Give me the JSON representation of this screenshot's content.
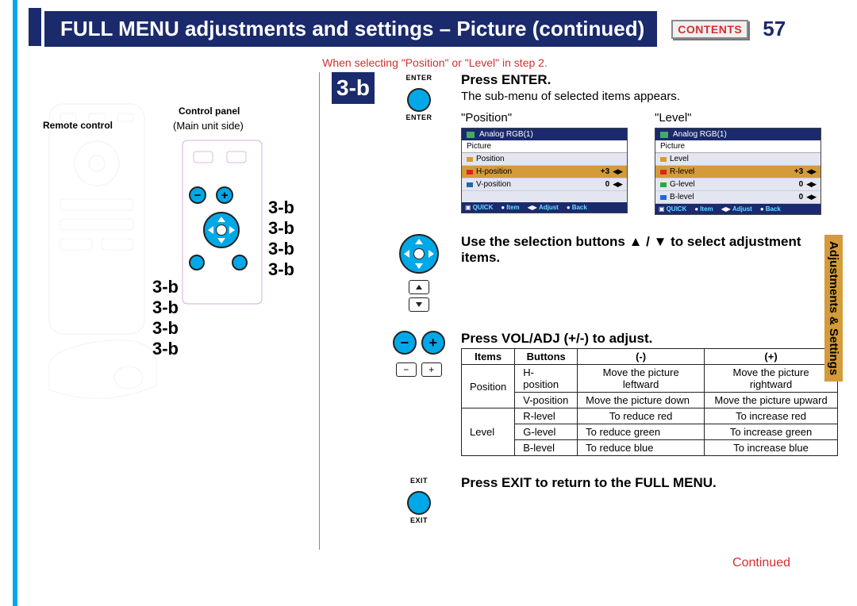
{
  "header": {
    "title": "FULL MENU adjustments and settings – Picture (continued)",
    "contents_label": "CONTENTS",
    "page_number": "57"
  },
  "note": "When selecting \"Position\" or \"Level\" in step 2.",
  "left": {
    "remote_label": "Remote control",
    "panel_label": "Control panel",
    "panel_sub": "(Main unit side)",
    "callouts_right": [
      "3-b",
      "3-b",
      "3-b",
      "3-b"
    ],
    "callouts_left": [
      "3-b",
      "3-b",
      "3-b",
      "3-b"
    ]
  },
  "step_chip": "3-b",
  "buttons": {
    "enter_cap": "ENTER",
    "exit_cap": "EXIT",
    "minus": "−",
    "plus": "+"
  },
  "sec_enter": {
    "title": "Press ENTER.",
    "sub": "The sub-menu of selected items appears.",
    "pos_label": "\"Position\"",
    "lvl_label": "\"Level\""
  },
  "submenu_position": {
    "source": "Analog RGB(1)",
    "section": "Picture",
    "parent": "Position",
    "rows": [
      {
        "icon": "#d22",
        "name": "H-position",
        "val": "+3"
      },
      {
        "icon": "#26a",
        "name": "V-position",
        "val": "0"
      }
    ],
    "footer": [
      "QUICK",
      "Item",
      "Adjust",
      "Back"
    ]
  },
  "submenu_level": {
    "source": "Analog RGB(1)",
    "section": "Picture",
    "parent": "Level",
    "rows": [
      {
        "icon": "#d22",
        "name": "R-level",
        "val": "+3"
      },
      {
        "icon": "#2a4",
        "name": "G-level",
        "val": "0"
      },
      {
        "icon": "#26d",
        "name": "B-level",
        "val": "0"
      }
    ],
    "footer": [
      "QUICK",
      "Item",
      "Adjust",
      "Back"
    ]
  },
  "sec_select": {
    "title_a": "Use the selection buttons ",
    "title_b": " to select adjustment items.",
    "arrows": "▲ / ▼"
  },
  "sec_adjust": {
    "title": "Press VOL/ADJ (+/-) to adjust."
  },
  "table": {
    "head": [
      "Items",
      "Buttons",
      "(-)",
      "(+)"
    ],
    "rows": [
      {
        "group": "Position",
        "item": "H-position",
        "minus": "Move the picture leftward",
        "plus": "Move the picture rightward"
      },
      {
        "group": "Position",
        "item": "V-position",
        "minus": "Move the picture down",
        "plus": "Move the picture upward"
      },
      {
        "group": "Level",
        "item": "R-level",
        "minus": "To reduce red",
        "plus": "To increase red"
      },
      {
        "group": "Level",
        "item": "G-level",
        "minus": "To reduce green",
        "plus": "To increase green"
      },
      {
        "group": "Level",
        "item": "B-level",
        "minus": "To reduce blue",
        "plus": "To increase blue"
      }
    ]
  },
  "sec_exit": {
    "title": "Press EXIT to return to the FULL MENU."
  },
  "continued": "Continued",
  "side_tab": "Adjustments &\nSettings"
}
